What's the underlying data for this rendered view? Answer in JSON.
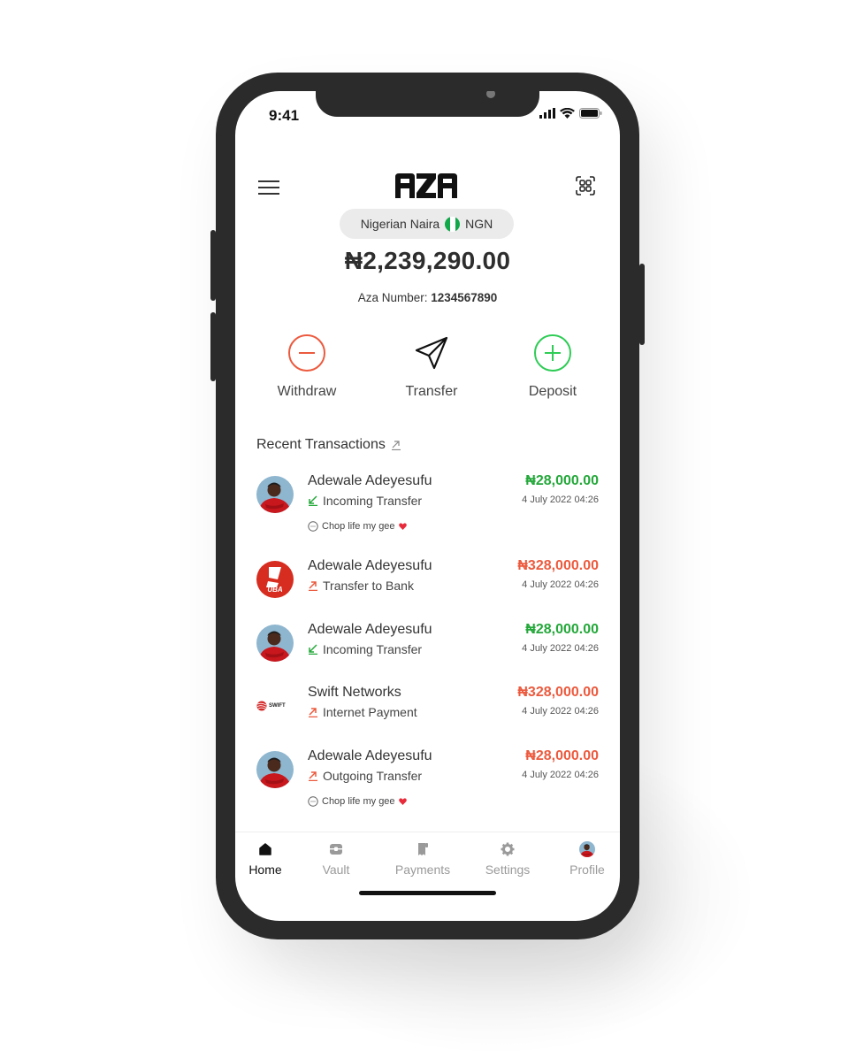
{
  "status_bar": {
    "time": "9:41"
  },
  "header": {
    "menu_icon": "hamburger-menu-icon",
    "logo_text": "AZA",
    "scan_icon": "qr-scan-icon"
  },
  "wallet": {
    "currency_name": "Nigerian Naira",
    "currency_code": "NGN",
    "flag_colors": [
      "#11a84a",
      "#ffffff",
      "#11a84a"
    ],
    "balance": "₦2,239,290.00",
    "aza_number_label": "Aza Number: ",
    "aza_number": "1234567890"
  },
  "actions": [
    {
      "label": "Withdraw",
      "icon": "minus-circle-icon",
      "color": "#ec5a3e"
    },
    {
      "label": "Transfer",
      "icon": "send-icon",
      "color": "#111111"
    },
    {
      "label": "Deposit",
      "icon": "plus-circle-icon",
      "color": "#2ecc55"
    }
  ],
  "recent": {
    "title": "Recent Transactions",
    "transactions": [
      {
        "name": "Adewale Adeyesufu",
        "type": "Incoming Transfer",
        "direction": "in",
        "amount": "₦28,000.00",
        "date": "4 July 2022 04:26",
        "note": "Chop life my gee",
        "avatar": "person-avatar"
      },
      {
        "name": "Adewale Adeyesufu",
        "type": "Transfer to Bank",
        "direction": "out",
        "amount": "₦328,000.00",
        "date": "4 July 2022 04:26",
        "avatar": "uba-bank-logo",
        "avatar_text": "UBA"
      },
      {
        "name": "Adewale Adeyesufu",
        "type": "Incoming Transfer",
        "direction": "in",
        "amount": "₦28,000.00",
        "date": "4 July 2022 04:26",
        "avatar": "person-avatar"
      },
      {
        "name": "Swift Networks",
        "type": "Internet Payment",
        "direction": "out",
        "amount": "₦328,000.00",
        "date": "4 July 2022 04:26",
        "avatar": "swift-networks-logo",
        "avatar_text": "SWIFT"
      },
      {
        "name": "Adewale Adeyesufu",
        "type": "Outgoing Transfer",
        "direction": "out",
        "amount": "₦28,000.00",
        "date": "4 July 2022 04:26",
        "note": "Chop life my gee",
        "avatar": "person-avatar"
      }
    ]
  },
  "tabbar": {
    "active": "Home",
    "tabs": [
      {
        "label": "Home",
        "icon": "home-icon"
      },
      {
        "label": "Vault",
        "icon": "vault-icon"
      },
      {
        "label": "Payments",
        "icon": "receipt-icon"
      },
      {
        "label": "Settings",
        "icon": "gear-icon"
      },
      {
        "label": "Profile",
        "icon": "profile-avatar-icon"
      }
    ]
  },
  "colors": {
    "in": "#24a83a",
    "out": "#ec5a3e",
    "uba": "#d62d20"
  }
}
